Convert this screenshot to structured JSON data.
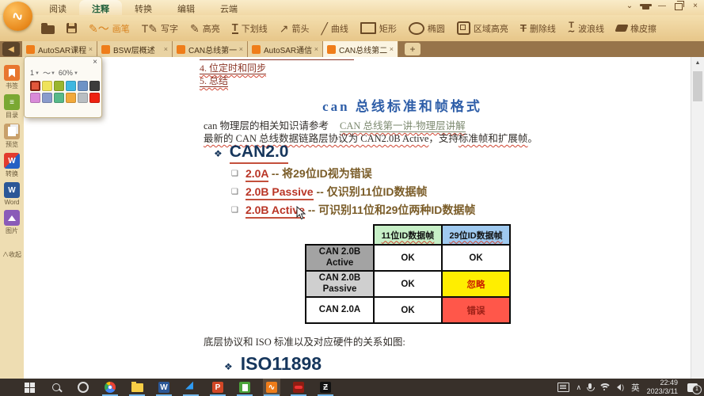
{
  "titlebar": {
    "menu_tabs": [
      "阅读",
      "注释",
      "转换",
      "编辑",
      "云端"
    ],
    "active_menu_tab": "注释",
    "controls": {
      "minimize": "—",
      "close": "×",
      "collapse": "⌄"
    }
  },
  "toolbar": {
    "brush_label": "画笔",
    "write_label": "写字",
    "highlight_label": "高亮",
    "underline_label": "下划线",
    "arrow_label": "箭头",
    "curve_label": "曲线",
    "rect_label": "矩形",
    "ellipse_label": "椭圆",
    "area_highlight_label": "区域高亮",
    "strike_label": "删除线",
    "wavy_label": "波浪线",
    "eraser_label": "橡皮擦"
  },
  "doc_tabs": {
    "tabs": [
      {
        "label": "AutoSAR课程..."
      },
      {
        "label": "BSW层概述"
      },
      {
        "label": "CAN总线第一..."
      },
      {
        "label": "AutoSAR通信..."
      },
      {
        "label": "CAN总线第二..."
      }
    ],
    "active_index": 4,
    "close_glyph": "×",
    "new_tab_glyph": "+"
  },
  "sidebar": {
    "items": [
      {
        "label": "书签"
      },
      {
        "label": "目录"
      },
      {
        "label": "预览"
      },
      {
        "label": "转换"
      },
      {
        "label": "Word"
      },
      {
        "label": "图片"
      }
    ],
    "collapse_label": "∧收起"
  },
  "annotation_panel": {
    "stroke_width": "1",
    "line_style_glyph": "〜",
    "opacity": "60%",
    "close_glyph": "×",
    "colors_row1": [
      "#e2573b",
      "#efe35a",
      "#9ab62e",
      "#3fb7e0",
      "#6e93c6",
      "#3c3c3c"
    ],
    "colors_row2": [
      "#d98ad9",
      "#8a9bcc",
      "#57b989",
      "#f2a93b",
      "#b9bec2",
      "#ee2211"
    ],
    "selected_color": "#e2573b"
  },
  "document": {
    "toc_item_4": "4. 位定时和同步",
    "toc_item_5": "5. 总结",
    "title": "can 总线标准和帧格式",
    "para1_text": "can 物理层的相关知识请参考",
    "para1_link": "CAN 总线第一讲-物理层讲解",
    "para2_seg1": "最新的 CAN 总线数据链路层协议为 CAN2.0B Active",
    "para2_seg2": "，支持",
    "para2_seg3": "标准帧和扩展帧",
    "para2_seg4": "。",
    "heading": "CAN2.0",
    "bullets": [
      {
        "term": "2.0A",
        "rest": " -- 将29位ID视为错误"
      },
      {
        "term": "2.0B Passive",
        "rest": " -- 仅识别11位ID数据帧"
      },
      {
        "term": "2.0B Active",
        "rest": " -- 可识别11位和29位两种ID数据帧"
      }
    ],
    "table": {
      "headers": [
        "11位ID数据帧",
        "29位ID数据帧"
      ],
      "rows": [
        {
          "label": "CAN 2.0B Active",
          "col1": "OK",
          "col2": "OK"
        },
        {
          "label": "CAN 2.0B Passive",
          "col1": "OK",
          "col2": "忽略"
        },
        {
          "label": "CAN 2.0A",
          "col1": "OK",
          "col2": "错误"
        }
      ]
    },
    "footer_text": "底层协议和 ISO 标准以及对应硬件的关系如图:",
    "next_heading": "ISO11898",
    "bullet_glyph": "❖",
    "square_glyph": "❑"
  },
  "taskbar": {
    "apps": {
      "word_letter": "W",
      "powerpoint_letter": "P",
      "capcut_letter": "Ƶ"
    },
    "tray": {
      "ime_label": "英",
      "time": "22:49",
      "date": "2023/3/11",
      "notification_count": "1"
    }
  }
}
